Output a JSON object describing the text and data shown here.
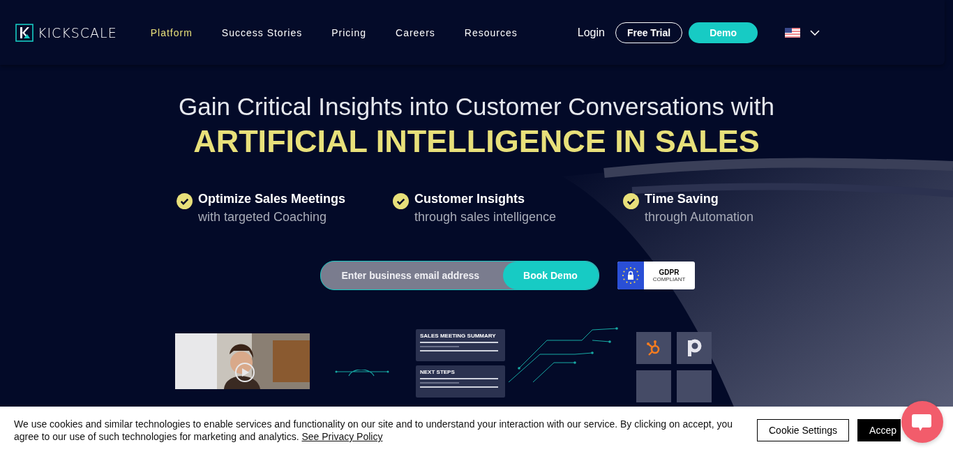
{
  "nav": {
    "brand": "KICKSCALE",
    "links": [
      {
        "label": "Platform",
        "selected": true
      },
      {
        "label": "Success Stories",
        "selected": false
      },
      {
        "label": "Pricing",
        "selected": false
      },
      {
        "label": "Careers",
        "selected": false
      },
      {
        "label": "Resources",
        "selected": false
      }
    ],
    "login": "Login",
    "free_trial": "Free Trial",
    "demo": "Demo"
  },
  "hero": {
    "title": "Gain Critical Insights into Customer Conversations with",
    "headline": "ARTIFICIAL INTELLIGENCE IN SALES",
    "features": [
      {
        "title": "Optimize Sales Meetings",
        "subtitle": "with targeted Coaching"
      },
      {
        "title": "Customer Insights",
        "subtitle": "through sales intelligence"
      },
      {
        "title": "Time Saving",
        "subtitle": "through Automation"
      }
    ],
    "email": {
      "placeholder": "Enter business email address"
    },
    "book_demo": "Book Demo",
    "badge": {
      "title": "GDPR",
      "subtitle": "COMPLIANT"
    }
  },
  "illustration": {
    "cards": [
      "SALES MEETING SUMMARY",
      "NEXT STEPS"
    ]
  },
  "cookie": {
    "text": "We use cookies and similar technologies to enable services and functionality on our site and to understand your interaction with our service. By clicking on accept, you agree to our use of such technologies for marketing and analytics.",
    "link": "See Privacy Policy",
    "settings": "Cookie Settings",
    "accept": "Accep"
  }
}
